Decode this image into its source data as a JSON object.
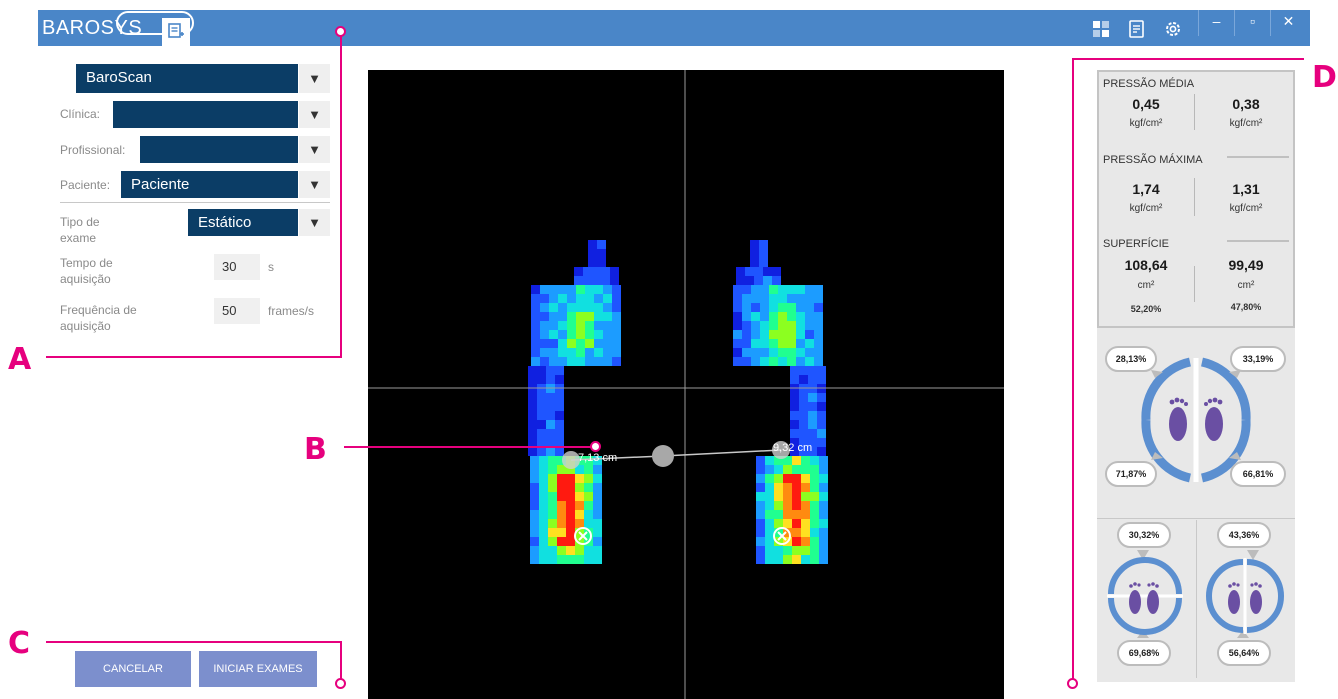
{
  "app": {
    "logo": "BAROSYS"
  },
  "titlebar": {
    "minimize": "–",
    "maximize": "▫",
    "close": "✕"
  },
  "form": {
    "device": "BaroScan",
    "clinic_label": "Clínica:",
    "clinic_value": "",
    "professional_label": "Profissional:",
    "professional_value": "",
    "patient_label": "Paciente:",
    "patient_value": "Paciente",
    "exam_type_label_1": "Tipo de",
    "exam_type_label_2": "exame",
    "exam_type_value": "Estático",
    "acq_time_label_1": "Tempo de",
    "acq_time_label_2": "aquisição",
    "acq_time_value": "30",
    "acq_time_unit": "s",
    "freq_label_1": "Frequência de",
    "freq_label_2": "aquisição",
    "freq_value": "50",
    "freq_unit": "frames/s"
  },
  "buttons": {
    "cancel": "CANCELAR",
    "start": "INICIAR EXAMES"
  },
  "annotations": {
    "a": "A",
    "b": "B",
    "c": "C",
    "d": "D"
  },
  "viewer": {
    "left_distance": "7,13 cm",
    "right_distance": "9,32 cm"
  },
  "stats": {
    "mean_pressure_title": "PRESSÃO MÉDIA",
    "mean_left": "0,45",
    "mean_right": "0,38",
    "max_pressure_title": "PRESSÃO MÁXIMA",
    "max_left": "1,74",
    "max_right": "1,31",
    "surface_title": "SUPERFÍCIE",
    "surface_left": "108,64",
    "surface_right": "99,49",
    "surface_left_pct": "52,20%",
    "surface_right_pct": "47,80%",
    "pressure_unit": "kgf/cm²",
    "area_unit": "cm²"
  },
  "distribution": {
    "fore_left": "28,13%",
    "fore_right": "33,19%",
    "rear_left": "71,87%",
    "rear_right": "66,81%",
    "lower_left_top": "30,32%",
    "lower_left_bottom": "69,68%",
    "lower_right_top": "43,36%",
    "lower_right_bottom": "56,64%"
  },
  "colors": {
    "titlebar": "#4a86c8",
    "select": "#0b3d66",
    "button": "#7c8fcd",
    "annotation": "#e6007e",
    "foot_icon": "#6a4fa3",
    "ring": "#5b8fd0"
  },
  "icons": [
    "new-exam-icon",
    "grid-icon",
    "report-icon",
    "gear-icon",
    "close-icon",
    "remove-marker-icon"
  ]
}
